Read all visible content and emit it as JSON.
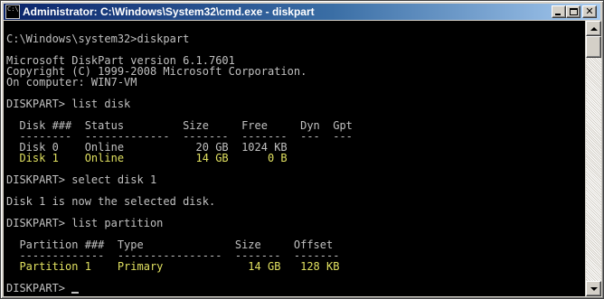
{
  "window": {
    "title": "Administrator: C:\\Windows\\System32\\cmd.exe - diskpart",
    "app_icon_label": "C:\\",
    "colors": {
      "titlebar_start": "#0a246a",
      "titlebar_end": "#a6caf0",
      "console_bg": "#000000",
      "console_text": "#c0c0c0",
      "console_highlight": "#e0e060"
    }
  },
  "console": {
    "lines": [
      "C:\\Windows\\system32>diskpart",
      "Microsoft DiskPart version 6.1.7601",
      "Copyright (C) 1999-2008 Microsoft Corporation.",
      "On computer: WIN7-VM",
      "DISKPART> list disk",
      "  Disk ###  Status         Size     Free     Dyn  Gpt",
      "  --------  -------------  -------  -------  ---  ---",
      "  Disk 0    Online           20 GB  1024 KB",
      "  Disk 1    Online           14 GB      0 B",
      "DISKPART> select disk 1",
      "Disk 1 is now the selected disk.",
      "DISKPART> list partition",
      "  Partition ###  Type              Size     Offset",
      "  -------------  ----------------  -------  -------",
      "  Partition 1    Primary             14 GB   128 KB",
      "DISKPART> "
    ]
  }
}
